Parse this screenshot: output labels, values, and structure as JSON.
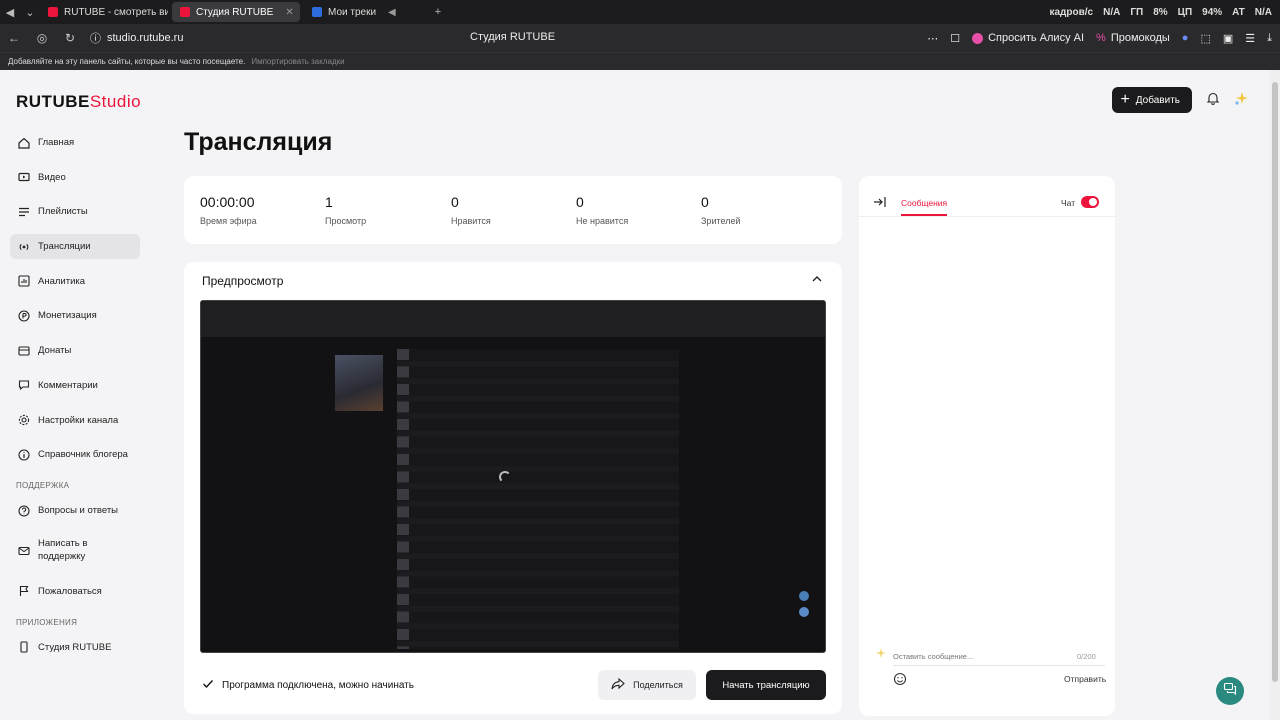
{
  "browser": {
    "tabs": [
      {
        "label": "RUTUBE - смотреть видео"
      },
      {
        "label": "Студия RUTUBE"
      },
      {
        "label": "Мои треки"
      }
    ],
    "sysinfo": [
      "кадров/с",
      "N/A",
      "ГП",
      "8%",
      "ЦП",
      "94%",
      "AT",
      "N/A"
    ],
    "url": "studio.rutube.ru",
    "page_title": "Студия RUTUBE",
    "alisa_label": "Спросить Алису AI",
    "promo_label": "Промокоды",
    "bookmarks_hint": "Добавляйте на эту панель сайты, которые вы часто посещаете.",
    "bookmarks_import": "Импортировать закладки"
  },
  "logo": {
    "brand": "RUTUBE",
    "suffix": "Studio"
  },
  "sidebar": {
    "items": [
      {
        "label": "Главная",
        "icon": "home-icon"
      },
      {
        "label": "Видео",
        "icon": "video-icon"
      },
      {
        "label": "Плейлисты",
        "icon": "playlist-icon"
      },
      {
        "label": "Трансляции",
        "icon": "broadcast-icon"
      },
      {
        "label": "Аналитика",
        "icon": "chart-icon"
      },
      {
        "label": "Монетизация",
        "icon": "coin-icon"
      },
      {
        "label": "Донаты",
        "icon": "donate-icon"
      },
      {
        "label": "Комментарии",
        "icon": "comment-icon"
      },
      {
        "label": "Настройки канала",
        "icon": "gear-icon"
      },
      {
        "label": "Справочник блогера",
        "icon": "info-icon"
      }
    ],
    "support_label": "ПОДДЕРЖКА",
    "support_items": [
      {
        "label": "Вопросы и ответы"
      },
      {
        "label": "Написать в поддержку"
      },
      {
        "label": "Пожаловаться"
      }
    ],
    "apps_label": "ПРИЛОЖЕНИЯ",
    "apps_items": [
      {
        "label": "Студия RUTUBE"
      }
    ]
  },
  "header": {
    "add_label": "Добавить"
  },
  "main": {
    "title": "Трансляция",
    "stats": [
      {
        "value": "00:00:00",
        "label": "Время эфира"
      },
      {
        "value": "1",
        "label": "Просмотр"
      },
      {
        "value": "0",
        "label": "Нравится"
      },
      {
        "value": "0",
        "label": "Не нравится"
      },
      {
        "value": "0",
        "label": "Зрителей"
      }
    ],
    "preview": {
      "title": "Предпросмотр",
      "status": "Программа подключена, можно начинать",
      "share_label": "Поделиться",
      "start_label": "Начать трансляцию"
    }
  },
  "chat": {
    "tab_label": "Сообщения",
    "toggle_label": "Чат",
    "input_placeholder": "Оставить сообщение...",
    "counter": "0/200",
    "send_label": "Отправить"
  },
  "colors": {
    "accent": "#ed143b",
    "dark": "#1b1b1d",
    "help": "#2a8a80"
  }
}
